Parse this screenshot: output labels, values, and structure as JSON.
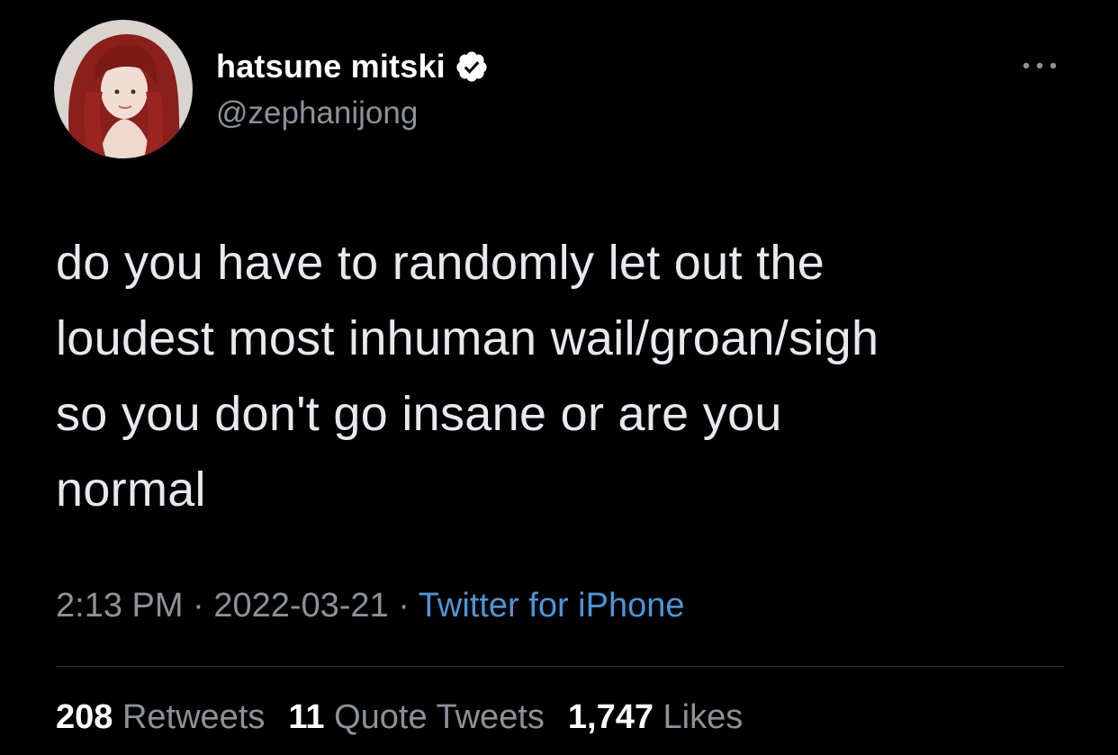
{
  "author": {
    "display_name": "hatsune mitski",
    "handle": "@zephanijong",
    "verified_icon": "verified-badge-icon",
    "avatar_icon": "profile-photo"
  },
  "tweet": {
    "lines": [
      "do you have to randomly let out the",
      "loudest most inhuman wail/groan/sigh",
      "so you don't go insane or are you",
      "normal"
    ],
    "time": "2:13 PM",
    "separator": "·",
    "date": "2022-03-21",
    "source": "Twitter for iPhone"
  },
  "stats": {
    "retweets_count": "208",
    "retweets_label": "Retweets",
    "quotes_count": "11",
    "quotes_label": "Quote Tweets",
    "likes_count": "1,747",
    "likes_label": "Likes"
  },
  "colors": {
    "background": "#000000",
    "text": "#e7e9ea",
    "muted": "#8b9299",
    "link": "#4a96d9",
    "divider": "#2f3336"
  }
}
